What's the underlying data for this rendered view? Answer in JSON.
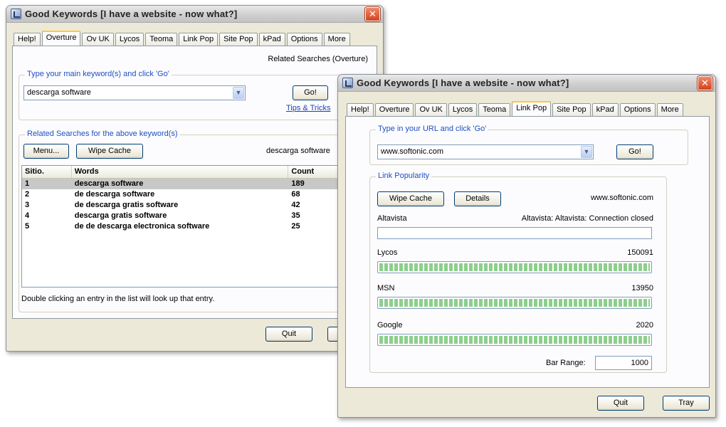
{
  "window1": {
    "title": "Good Keywords [I have a website - now what?]",
    "close": "✕",
    "tabs": [
      "Help!",
      "Overture",
      "Ov UK",
      "Lycos",
      "Teoma",
      "Link Pop",
      "Site Pop",
      "kPad",
      "Options",
      "More"
    ],
    "active_tab": "Overture",
    "related_header": "Related Searches (Overture)",
    "keyword_group_legend": "Type your main keyword(s) and click 'Go'",
    "keyword_value": "descarga software",
    "go_label": "Go!",
    "tips_link": "Tips & Tricks",
    "related_group_legend": "Related Searches for the above keyword(s)",
    "menu_label": "Menu...",
    "wipe_cache_label": "Wipe Cache",
    "current_keyword": "descarga software",
    "table": {
      "columns": [
        "Sitio.",
        "Words",
        "Count"
      ],
      "rows": [
        {
          "pos": "1",
          "words": "descarga software",
          "count": "189"
        },
        {
          "pos": "2",
          "words": "de descarga software",
          "count": "68"
        },
        {
          "pos": "3",
          "words": "de descarga gratis software",
          "count": "42"
        },
        {
          "pos": "4",
          "words": "descarga gratis software",
          "count": "35"
        },
        {
          "pos": "5",
          "words": "de de descarga electronica software",
          "count": "25"
        }
      ]
    },
    "hint": "Double clicking an entry in the list will look up that entry.",
    "quit_label": "Quit"
  },
  "window2": {
    "title": "Good Keywords [I have a website - now what?]",
    "close": "✕",
    "tabs": [
      "Help!",
      "Overture",
      "Ov UK",
      "Lycos",
      "Teoma",
      "Link Pop",
      "Site Pop",
      "kPad",
      "Options",
      "More"
    ],
    "active_tab": "Link Pop",
    "url_group_legend": "Type in your URL and click 'Go'",
    "url_value": "www.softonic.com",
    "go_label": "Go!",
    "link_pop_legend": "Link Popularity",
    "wipe_cache_label": "Wipe Cache",
    "details_label": "Details",
    "site_label": "www.softonic.com",
    "engines": [
      {
        "name": "Altavista",
        "value": "Altavista: Altavista: Connection closed",
        "fill": 0
      },
      {
        "name": "Lycos",
        "value": "150091",
        "fill": 1.0
      },
      {
        "name": "MSN",
        "value": "13950",
        "fill": 1.0
      },
      {
        "name": "Google",
        "value": "2020",
        "fill": 1.0
      }
    ],
    "bar_range_label": "Bar Range:",
    "bar_range_value": "1000",
    "quit_label": "Quit",
    "tray_label": "Tray"
  },
  "colors": {
    "window_bg": "#ece9d8",
    "legend_blue": "#1f4fc0",
    "progress_green": "#8ccf8c",
    "selected_row": "#c8c8c8",
    "close_red": "#d2421e"
  },
  "icons": [
    "app-icon",
    "close-icon",
    "dropdown-arrow-icon"
  ]
}
